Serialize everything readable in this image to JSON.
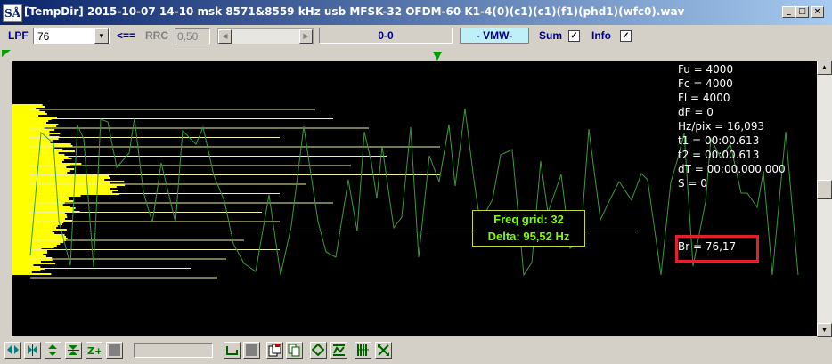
{
  "window": {
    "icon_text": "SÅ",
    "title": "[TempDir] 2015-10-07 14-10 msk 8571&8559 kHz usb MFSK-32 OFDM-60 K1-4(0)(c1)(c1)(f1)(phd1)(wfc0).wav",
    "controls": [
      "minimize-icon",
      "maximize-icon",
      "close-icon"
    ]
  },
  "toolbar": {
    "lpf_label": "LPF",
    "lpf_value": "76",
    "arrow_label": "<==",
    "rrc_label": "RRC",
    "rrc_value": "0,50",
    "counter": "0-0",
    "mode": "- VMW-",
    "sum_label": "Sum",
    "sum_checked": true,
    "info_label": "Info",
    "info_checked": true
  },
  "plot": {
    "info_lines": [
      "Fu = 4000",
      "Fc = 4000",
      "Fl = 4000",
      "dF = 0",
      "Hz/pix = 16,093",
      "t1 = 00:00.613",
      "t2 = 00:00.613",
      "dT = 00:00.000.000",
      "S = 0"
    ],
    "br": "Br = 76,17",
    "freq_grid": "Freq grid: 32",
    "delta": "Delta: 95,52 Hz",
    "colors": {
      "background": "#000000",
      "spectrum": "#ffff00",
      "waveform": "#3a9a3a",
      "highlight": "#e0202a",
      "marker": "#00a000"
    }
  },
  "bottom_toolbar": {
    "buttons": [
      "expand-horizontal-icon",
      "shrink-horizontal-icon",
      "expand-vertical-icon",
      "shrink-vertical-icon",
      "zoom-plus-icon",
      "stop-icon",
      "level-icon",
      "square-icon",
      "save-file-icon",
      "copy-icon",
      "diamond-icon",
      "waveform-icon",
      "grid-icon",
      "cross-icon"
    ]
  }
}
